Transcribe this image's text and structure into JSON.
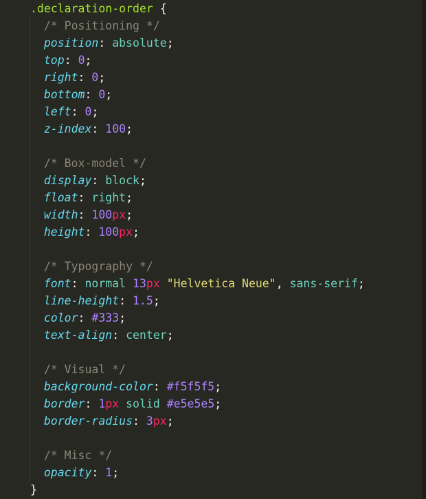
{
  "editor": {
    "language": "css",
    "theme_background": "#272822",
    "right_edge_color": "#1d1e19",
    "indent_guide_color": "#3b3c35"
  },
  "palette": {
    "selector": "#a6e22e",
    "punctuation": "#f8f8f2",
    "comment": "#8a8678",
    "property": "#66d9ef",
    "value": "#6fd3c0",
    "number": "#ae81ff",
    "unit": "#f9265f",
    "string": "#e6db74",
    "hex_color": "#ae81ff"
  },
  "code": {
    "lines": [
      {
        "type": "selector",
        "text": ".declaration-order {",
        "tokens": [
          {
            "t": "sel",
            "v": ".declaration-order"
          },
          {
            "t": "plain",
            "v": " "
          },
          {
            "t": "punct",
            "v": "{"
          }
        ]
      },
      {
        "type": "comment",
        "text": "/* Positioning */",
        "tokens": [
          {
            "t": "plain",
            "v": "  "
          },
          {
            "t": "cmt",
            "v": "/* Positioning */"
          }
        ]
      },
      {
        "type": "decl",
        "text": "position: absolute;",
        "tokens": [
          {
            "t": "plain",
            "v": "  "
          },
          {
            "t": "prop",
            "v": "position"
          },
          {
            "t": "punct",
            "v": ":"
          },
          {
            "t": "plain",
            "v": " "
          },
          {
            "t": "val",
            "v": "absolute"
          },
          {
            "t": "punct",
            "v": ";"
          }
        ]
      },
      {
        "type": "decl",
        "text": "top: 0;",
        "tokens": [
          {
            "t": "plain",
            "v": "  "
          },
          {
            "t": "prop",
            "v": "top"
          },
          {
            "t": "punct",
            "v": ":"
          },
          {
            "t": "plain",
            "v": " "
          },
          {
            "t": "num",
            "v": "0"
          },
          {
            "t": "punct",
            "v": ";"
          }
        ]
      },
      {
        "type": "decl",
        "text": "right: 0;",
        "tokens": [
          {
            "t": "plain",
            "v": "  "
          },
          {
            "t": "prop",
            "v": "right"
          },
          {
            "t": "punct",
            "v": ":"
          },
          {
            "t": "plain",
            "v": " "
          },
          {
            "t": "num",
            "v": "0"
          },
          {
            "t": "punct",
            "v": ";"
          }
        ]
      },
      {
        "type": "decl",
        "text": "bottom: 0;",
        "tokens": [
          {
            "t": "plain",
            "v": "  "
          },
          {
            "t": "prop",
            "v": "bottom"
          },
          {
            "t": "punct",
            "v": ":"
          },
          {
            "t": "plain",
            "v": " "
          },
          {
            "t": "num",
            "v": "0"
          },
          {
            "t": "punct",
            "v": ";"
          }
        ]
      },
      {
        "type": "decl",
        "text": "left: 0;",
        "tokens": [
          {
            "t": "plain",
            "v": "  "
          },
          {
            "t": "prop",
            "v": "left"
          },
          {
            "t": "punct",
            "v": ":"
          },
          {
            "t": "plain",
            "v": " "
          },
          {
            "t": "num",
            "v": "0"
          },
          {
            "t": "punct",
            "v": ";"
          }
        ]
      },
      {
        "type": "decl",
        "text": "z-index: 100;",
        "tokens": [
          {
            "t": "plain",
            "v": "  "
          },
          {
            "t": "prop",
            "v": "z-index"
          },
          {
            "t": "punct",
            "v": ":"
          },
          {
            "t": "plain",
            "v": " "
          },
          {
            "t": "num",
            "v": "100"
          },
          {
            "t": "punct",
            "v": ";"
          }
        ]
      },
      {
        "type": "blank",
        "text": "",
        "tokens": []
      },
      {
        "type": "comment",
        "text": "/* Box-model */",
        "tokens": [
          {
            "t": "plain",
            "v": "  "
          },
          {
            "t": "cmt",
            "v": "/* Box-model */"
          }
        ]
      },
      {
        "type": "decl",
        "text": "display: block;",
        "tokens": [
          {
            "t": "plain",
            "v": "  "
          },
          {
            "t": "prop",
            "v": "display"
          },
          {
            "t": "punct",
            "v": ":"
          },
          {
            "t": "plain",
            "v": " "
          },
          {
            "t": "val",
            "v": "block"
          },
          {
            "t": "punct",
            "v": ";"
          }
        ]
      },
      {
        "type": "decl",
        "text": "float: right;",
        "tokens": [
          {
            "t": "plain",
            "v": "  "
          },
          {
            "t": "prop",
            "v": "float"
          },
          {
            "t": "punct",
            "v": ":"
          },
          {
            "t": "plain",
            "v": " "
          },
          {
            "t": "val",
            "v": "right"
          },
          {
            "t": "punct",
            "v": ";"
          }
        ]
      },
      {
        "type": "decl",
        "text": "width: 100px;",
        "tokens": [
          {
            "t": "plain",
            "v": "  "
          },
          {
            "t": "prop",
            "v": "width"
          },
          {
            "t": "punct",
            "v": ":"
          },
          {
            "t": "plain",
            "v": " "
          },
          {
            "t": "num",
            "v": "100"
          },
          {
            "t": "unit",
            "v": "px"
          },
          {
            "t": "punct",
            "v": ";"
          }
        ]
      },
      {
        "type": "decl",
        "text": "height: 100px;",
        "tokens": [
          {
            "t": "plain",
            "v": "  "
          },
          {
            "t": "prop",
            "v": "height"
          },
          {
            "t": "punct",
            "v": ":"
          },
          {
            "t": "plain",
            "v": " "
          },
          {
            "t": "num",
            "v": "100"
          },
          {
            "t": "unit",
            "v": "px"
          },
          {
            "t": "punct",
            "v": ";"
          }
        ]
      },
      {
        "type": "blank",
        "text": "",
        "tokens": []
      },
      {
        "type": "comment",
        "text": "/* Typography */",
        "tokens": [
          {
            "t": "plain",
            "v": "  "
          },
          {
            "t": "cmt",
            "v": "/* Typography */"
          }
        ]
      },
      {
        "type": "decl",
        "text": "font: normal 13px \"Helvetica Neue\", sans-serif;",
        "tokens": [
          {
            "t": "plain",
            "v": "  "
          },
          {
            "t": "prop",
            "v": "font"
          },
          {
            "t": "punct",
            "v": ":"
          },
          {
            "t": "plain",
            "v": " "
          },
          {
            "t": "val",
            "v": "normal"
          },
          {
            "t": "plain",
            "v": " "
          },
          {
            "t": "num",
            "v": "13"
          },
          {
            "t": "unit",
            "v": "px"
          },
          {
            "t": "plain",
            "v": " "
          },
          {
            "t": "str",
            "v": "\"Helvetica Neue\""
          },
          {
            "t": "punct",
            "v": ","
          },
          {
            "t": "plain",
            "v": " "
          },
          {
            "t": "val",
            "v": "sans-serif"
          },
          {
            "t": "punct",
            "v": ";"
          }
        ]
      },
      {
        "type": "decl",
        "text": "line-height: 1.5;",
        "tokens": [
          {
            "t": "plain",
            "v": "  "
          },
          {
            "t": "prop",
            "v": "line-height"
          },
          {
            "t": "punct",
            "v": ":"
          },
          {
            "t": "plain",
            "v": " "
          },
          {
            "t": "num",
            "v": "1.5"
          },
          {
            "t": "punct",
            "v": ";"
          }
        ]
      },
      {
        "type": "decl",
        "text": "color: #333;",
        "tokens": [
          {
            "t": "plain",
            "v": "  "
          },
          {
            "t": "prop",
            "v": "color"
          },
          {
            "t": "punct",
            "v": ":"
          },
          {
            "t": "plain",
            "v": " "
          },
          {
            "t": "hex",
            "v": "#333"
          },
          {
            "t": "punct",
            "v": ";"
          }
        ]
      },
      {
        "type": "decl",
        "text": "text-align: center;",
        "tokens": [
          {
            "t": "plain",
            "v": "  "
          },
          {
            "t": "prop",
            "v": "text-align"
          },
          {
            "t": "punct",
            "v": ":"
          },
          {
            "t": "plain",
            "v": " "
          },
          {
            "t": "val",
            "v": "center"
          },
          {
            "t": "punct",
            "v": ";"
          }
        ]
      },
      {
        "type": "blank",
        "text": "",
        "tokens": []
      },
      {
        "type": "comment",
        "text": "/* Visual */",
        "tokens": [
          {
            "t": "plain",
            "v": "  "
          },
          {
            "t": "cmt",
            "v": "/* Visual */"
          }
        ]
      },
      {
        "type": "decl",
        "text": "background-color: #f5f5f5;",
        "tokens": [
          {
            "t": "plain",
            "v": "  "
          },
          {
            "t": "prop",
            "v": "background-color"
          },
          {
            "t": "punct",
            "v": ":"
          },
          {
            "t": "plain",
            "v": " "
          },
          {
            "t": "hex",
            "v": "#f5f5f5"
          },
          {
            "t": "punct",
            "v": ";"
          }
        ]
      },
      {
        "type": "decl",
        "text": "border: 1px solid #e5e5e5;",
        "tokens": [
          {
            "t": "plain",
            "v": "  "
          },
          {
            "t": "prop",
            "v": "border"
          },
          {
            "t": "punct",
            "v": ":"
          },
          {
            "t": "plain",
            "v": " "
          },
          {
            "t": "num",
            "v": "1"
          },
          {
            "t": "unit",
            "v": "px"
          },
          {
            "t": "plain",
            "v": " "
          },
          {
            "t": "val",
            "v": "solid"
          },
          {
            "t": "plain",
            "v": " "
          },
          {
            "t": "hex",
            "v": "#e5e5e5"
          },
          {
            "t": "punct",
            "v": ";"
          }
        ]
      },
      {
        "type": "decl",
        "text": "border-radius: 3px;",
        "tokens": [
          {
            "t": "plain",
            "v": "  "
          },
          {
            "t": "prop",
            "v": "border-radius"
          },
          {
            "t": "punct",
            "v": ":"
          },
          {
            "t": "plain",
            "v": " "
          },
          {
            "t": "num",
            "v": "3"
          },
          {
            "t": "unit",
            "v": "px"
          },
          {
            "t": "punct",
            "v": ";"
          }
        ]
      },
      {
        "type": "blank",
        "text": "",
        "tokens": []
      },
      {
        "type": "comment",
        "text": "/* Misc */",
        "tokens": [
          {
            "t": "plain",
            "v": "  "
          },
          {
            "t": "cmt",
            "v": "/* Misc */"
          }
        ]
      },
      {
        "type": "decl",
        "text": "opacity: 1;",
        "tokens": [
          {
            "t": "plain",
            "v": "  "
          },
          {
            "t": "prop",
            "v": "opacity"
          },
          {
            "t": "punct",
            "v": ":"
          },
          {
            "t": "plain",
            "v": " "
          },
          {
            "t": "num",
            "v": "1"
          },
          {
            "t": "punct",
            "v": ";"
          }
        ]
      },
      {
        "type": "close",
        "text": "}",
        "tokens": [
          {
            "t": "punct",
            "v": "}"
          }
        ]
      }
    ]
  }
}
